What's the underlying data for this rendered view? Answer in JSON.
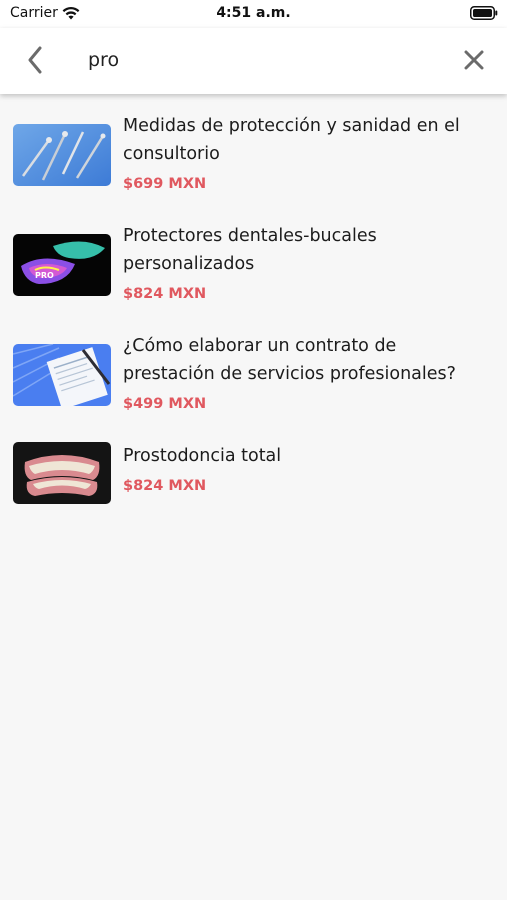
{
  "status_bar": {
    "carrier": "Carrier",
    "time": "4:51 a.m."
  },
  "search": {
    "value": "pro",
    "back_icon": "chevron-left-icon",
    "clear_icon": "close-icon"
  },
  "results": [
    {
      "title": "Medidas de protección y sanidad en el consultorio",
      "price": "$699 MXN",
      "thumbnail": "dental-instruments-image"
    },
    {
      "title": "Protectores dentales-bucales personalizados",
      "price": "$824 MXN",
      "thumbnail": "mouthguard-image"
    },
    {
      "title": "¿Cómo elaborar un contrato de prestación de servicios profesionales?",
      "price": "$499 MXN",
      "thumbnail": "contract-document-image"
    },
    {
      "title": "Prostodoncia total",
      "price": "$824 MXN",
      "thumbnail": "denture-image"
    }
  ],
  "colors": {
    "price": "#e0585f",
    "caret": "#2f7ff0",
    "background": "#f7f7f7"
  }
}
